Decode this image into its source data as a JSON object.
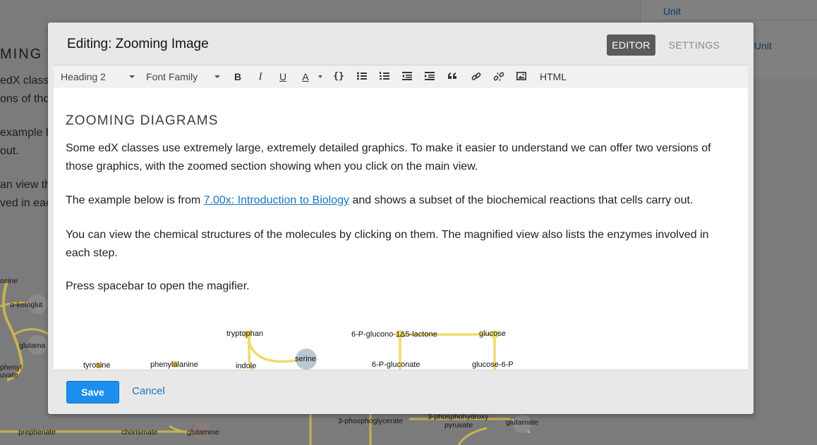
{
  "background": {
    "side_items": [
      "Unit",
      "Unit"
    ],
    "page_title_fragment": "MING D",
    "text_fragments": [
      "edX class",
      "ons of tho",
      "example b",
      "out.",
      "an view th",
      "ved in eac"
    ],
    "diagram_labels": {
      "tyrosine": "osine",
      "ketoglutarate": "α-ketoglut",
      "glutamate_left": "glutama",
      "phenylpyruvate_1": "phenyl",
      "phenylpyruvate_2": "uvate",
      "prephenate": "prephenate",
      "chorismate": "chorismate",
      "glutamine": "glutamine",
      "phosphoglycerate": "3-phosphoglycerate",
      "phosphohydroxypyruvate_1": "3-phosphohydroxy",
      "phosphohydroxypyruvate_2": "pyruvate",
      "glutamate_right": "glutamate"
    },
    "colors": {
      "overlay": "#7b7b7b",
      "pathway": "#d9c25a",
      "node": "#8a8a8a"
    }
  },
  "modal": {
    "title": "Editing: Zooming Image",
    "tabs": {
      "editor": "EDITOR",
      "settings": "SETTINGS"
    },
    "toolbar": {
      "block_format": "Heading 2",
      "font_family": "Font Family",
      "bold": "B",
      "italic": "I",
      "underline": "U",
      "text_color": "A",
      "code": "{}",
      "html": "HTML"
    },
    "content": {
      "heading": "ZOOMING DIAGRAMS",
      "p1": "Some edX classes use extremely large, extremely detailed graphics. To make it easier to understand we can offer two versions of those graphics, with the zoomed section showing when you click on the main view.",
      "p2_before": "The example below is from ",
      "p2_link": "7.00x: Introduction to Biology",
      "p2_after": " and shows a subset of the biochemical reactions that cells carry out.",
      "p3": "You can view the chemical structures of the molecules by clicking on them. The magnified view also lists the enzymes involved in each step.",
      "p4": "Press spacebar to open the magifier.",
      "diagram_labels": {
        "tryptophan": "tryptophan",
        "serine": "serine",
        "indole": "indole",
        "tyrosine": "tyrosine",
        "phenylalanine": "phenylalanine",
        "lactone": "6-P-glucono-1Δ5-lactone",
        "glucose": "glucose",
        "gluconate": "6-P-gluconate",
        "glucose6p": "glucose-6-P"
      }
    },
    "footer": {
      "save": "Save",
      "cancel": "Cancel"
    },
    "colors": {
      "accent": "#1a8ff0",
      "link": "#1a74c4",
      "tab_active": "#5b5b5b",
      "pathway": "#f2dc6e"
    }
  }
}
